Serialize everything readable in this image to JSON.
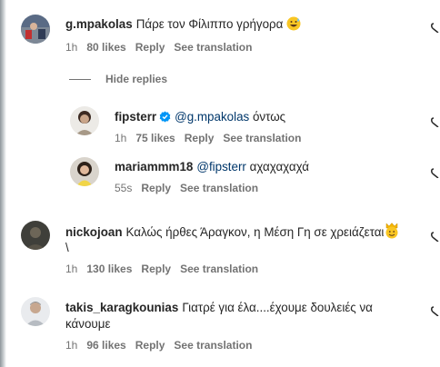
{
  "comments": [
    {
      "username": "g.mpakolas",
      "text": "Πάρε τον Φίλιππο γρήγορα",
      "emoji": "grinning-sweat",
      "time": "1h",
      "likes": "80 likes",
      "reply_label": "Reply",
      "translate_label": "See translation"
    },
    {
      "username": "nickojoan",
      "text_line1": "Καλώς ήρθες Άραγκον, η Μέση Γη σε χρειάζεται",
      "text_line2": "\\",
      "emoji": "crown-face",
      "time": "1h",
      "likes": "130 likes",
      "reply_label": "Reply",
      "translate_label": "See translation"
    },
    {
      "username": "takis_karagkounias",
      "text_line1": "Γιατρέ για έλα....έχουμε δουλειές να",
      "text_line2": "κάνουμε",
      "time": "1h",
      "likes": "96 likes",
      "reply_label": "Reply",
      "translate_label": "See translation"
    }
  ],
  "hide_replies_label": "Hide replies",
  "replies": [
    {
      "username": "fipsterr",
      "verified": true,
      "mention": "@g.mpakolas",
      "text": "όντως",
      "time": "1h",
      "likes": "75 likes",
      "reply_label": "Reply",
      "translate_label": "See translation"
    },
    {
      "username": "mariammm18",
      "mention": "@fipsterr",
      "text": "αχαχαχαχά",
      "time": "55s",
      "reply_label": "Reply",
      "translate_label": "See translation"
    }
  ],
  "colors": {
    "text": "#262626",
    "secondary": "#737373",
    "mention": "#00376b",
    "verified": "#0095f6"
  }
}
